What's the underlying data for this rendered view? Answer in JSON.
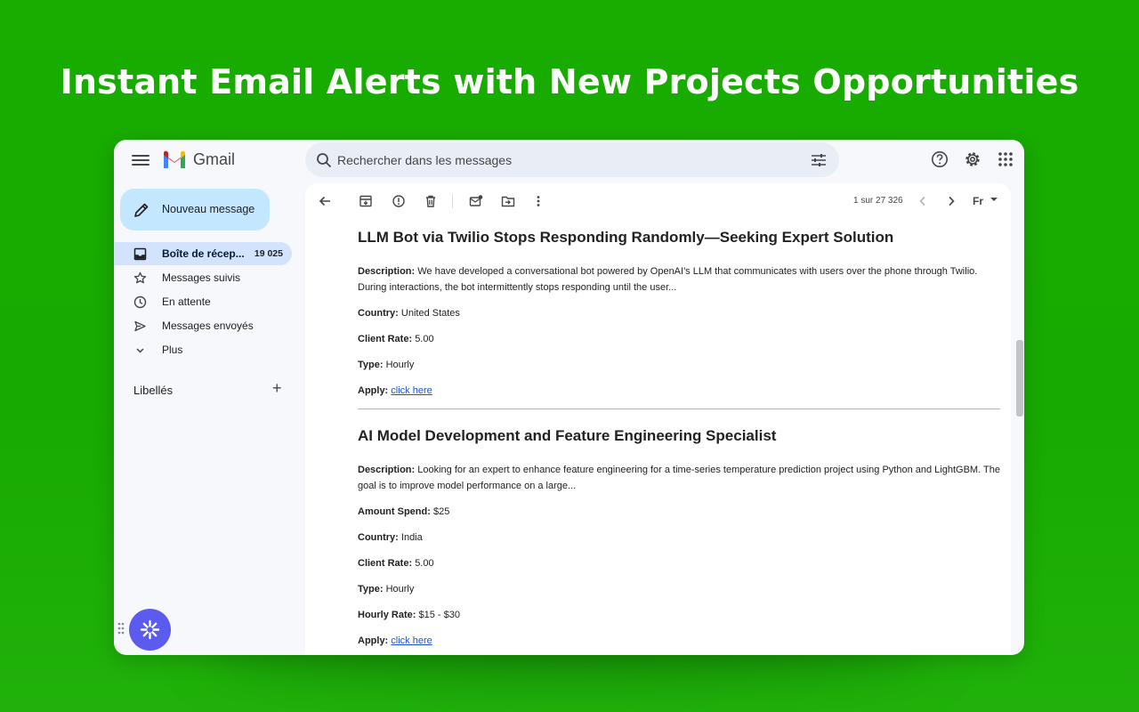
{
  "headline": "Instant Email Alerts with New Projects Opportunities",
  "app": {
    "brand": "Gmail"
  },
  "search": {
    "placeholder": "Rechercher dans les messages"
  },
  "sidebar": {
    "compose_label": "Nouveau message",
    "items": [
      {
        "label": "Boîte de récep...",
        "count": "19 025",
        "icon": "inbox-icon",
        "active": true
      },
      {
        "label": "Messages suivis",
        "icon": "star-icon"
      },
      {
        "label": "En attente",
        "icon": "clock-icon"
      },
      {
        "label": "Messages envoyés",
        "icon": "send-icon"
      },
      {
        "label": "Plus",
        "icon": "chevron-down-icon"
      }
    ],
    "labels_heading": "Libellés",
    "labels_add": "+"
  },
  "toolbar": {
    "pager": "1 sur 27 326",
    "lang": "Fr"
  },
  "jobs": [
    {
      "title": "LLM Bot via Twilio Stops Responding Randomly—Seeking Expert Solution",
      "desc_label": "Description:",
      "desc": "We have developed a conversational bot powered by OpenAI's LLM that communicates with users over the phone through Twilio. During interactions, the bot intermittently stops responding until the user...",
      "fields": [
        {
          "label": "Country:",
          "value": "United States"
        },
        {
          "label": "Client Rate:",
          "value": "5.00"
        },
        {
          "label": "Type:",
          "value": "Hourly"
        }
      ],
      "apply_label": "Apply:",
      "apply_link": "click here"
    },
    {
      "title": "AI Model Development and Feature Engineering Specialist",
      "desc_label": "Description:",
      "desc": "Looking for an expert to enhance feature engineering for a time-series temperature prediction project using Python and LightGBM. The goal is to improve model performance on a large...",
      "fields": [
        {
          "label": "Amount Spend:",
          "value": "$25"
        },
        {
          "label": "Country:",
          "value": "India"
        },
        {
          "label": "Client Rate:",
          "value": "5.00"
        },
        {
          "label": "Type:",
          "value": "Hourly"
        },
        {
          "label": "Hourly Rate:",
          "value": "$15 - $30"
        }
      ],
      "apply_label": "Apply:",
      "apply_link": "click here"
    }
  ]
}
